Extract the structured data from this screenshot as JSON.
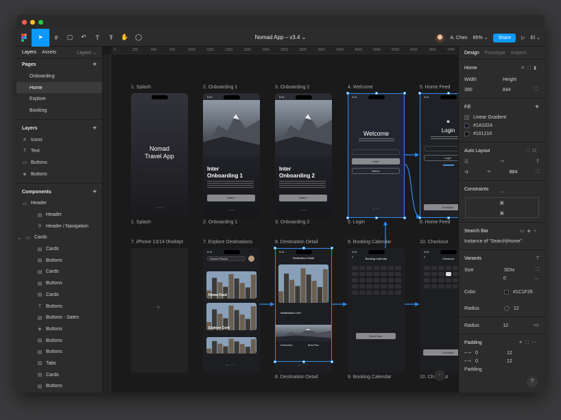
{
  "app": {
    "title": "Nomad App – v3.4",
    "user_name": "A. Chen",
    "zoom": "85%",
    "share_label": "Share",
    "dev_label": "Eİ"
  },
  "left_panel": {
    "tabs": [
      "Layers",
      "Assets"
    ],
    "tab_right": "Layers",
    "pages_title": "Pages",
    "pages": [
      "Onboarding",
      "Home",
      "Explore",
      "Booking"
    ],
    "layers_title": "Layers",
    "layers": [
      {
        "icon": "#",
        "label": "Icons"
      },
      {
        "icon": "T",
        "label": "Text"
      },
      {
        "icon": "▭",
        "label": "Buttons"
      },
      {
        "icon": "◈",
        "label": "Buttons"
      }
    ],
    "components_title": "Components",
    "components": [
      {
        "icon": "▭",
        "label": "Header",
        "indent": 0
      },
      {
        "icon": "▤",
        "label": "Header",
        "indent": 1
      },
      {
        "icon": "⚲",
        "label": "Header / Navigation",
        "indent": 1
      },
      {
        "icon": "▭",
        "label": "Cards",
        "indent": 0
      },
      {
        "icon": "▤",
        "label": "Cards",
        "indent": 1
      },
      {
        "icon": "▤",
        "label": "Buttons",
        "indent": 1
      },
      {
        "icon": "▤",
        "label": "Cards",
        "indent": 1
      },
      {
        "icon": "▤",
        "label": "Buttons",
        "indent": 1
      },
      {
        "icon": "▤",
        "label": "Cards",
        "indent": 1
      },
      {
        "icon": "T",
        "label": "Buttons",
        "indent": 1
      },
      {
        "icon": "▤",
        "label": "Buttons - Sates",
        "indent": 1
      },
      {
        "icon": "◈",
        "label": "Buttons",
        "indent": 1
      },
      {
        "icon": "▤",
        "label": "Buttons",
        "indent": 1
      },
      {
        "icon": "▤",
        "label": "Buttons",
        "indent": 1
      },
      {
        "icon": "▤",
        "label": "Tabs",
        "indent": 1
      },
      {
        "icon": "▤",
        "label": "Cards",
        "indent": 1
      },
      {
        "icon": "▤",
        "label": "Buttons",
        "indent": 1
      }
    ]
  },
  "canvas": {
    "ruler_ticks": [
      "0",
      "250",
      "400",
      "500",
      "1000",
      "1500",
      "1000",
      "1500",
      "2000",
      "2500",
      "3000",
      "3500",
      "4000",
      "4500",
      "5000",
      "5500",
      "6000",
      "1800",
      "7000"
    ],
    "frames": [
      {
        "label": "1. Splash",
        "bottom_label": "1. Splash",
        "title": "Nomad\nTravel App"
      },
      {
        "label": "2. Onboarding 1",
        "bottom_label": "2. Onboarding 1",
        "title": "Inter\nOnboarding 1",
        "button": "Button"
      },
      {
        "label": "3. Onboarding 2",
        "bottom_label": "3. Onboarding 2",
        "title": "Inter\nOnboarding 2",
        "button": "Button"
      },
      {
        "label": "4. Welcome",
        "bottom_label": "5. Login",
        "title": "Welcome",
        "login": "Login",
        "button": "Button"
      },
      {
        "label": "5. Home Feed",
        "bottom_label": "6. Home Feed",
        "title": "Login",
        "login": "Login",
        "extra": "Prototype"
      },
      {
        "label": "7. iPhone 13/14 0hx84pt",
        "bottom_label": ""
      },
      {
        "label": "7. Explore Destinations",
        "bottom_label": "",
        "search": "Search Places",
        "card1": "Home Feed",
        "card2": "Explore Cent"
      },
      {
        "label": "8. Destination Detail",
        "bottom_label": "8. Destination Detail",
        "title": "Destination Detail",
        "card": "Destination Cent",
        "thumb1": "Destination",
        "thumb2": "Build Plan"
      },
      {
        "label": "9. Booking Calendar",
        "bottom_label": "9. Booking Calendar",
        "title": "Booking Calendar",
        "button": "Book Now"
      },
      {
        "label": "10. Checkout",
        "bottom_label": "10. Checkout",
        "title": "Checkout",
        "button": "Checkout"
      }
    ],
    "status_time": "9:41"
  },
  "right_panel": {
    "tabs": [
      "Design",
      "Prototype",
      "Inspect"
    ],
    "home_title": "Home",
    "width_label": "Width",
    "height_label": "Height",
    "width": "390",
    "height": "844",
    "fill_title": "Fill",
    "fills": [
      "Linear Gradient",
      "#1A1024",
      "#101216"
    ],
    "auto_layout_title": "Auto Layout",
    "auto_layout_value": "884",
    "constraints_title": "Constraints",
    "search_bar_title": "Search Bar",
    "instance_of": "Instance of \"Search|Home\"",
    "variants_title": "Variants",
    "size_label": "Size",
    "size_value": "SDIx",
    "size_value2": "0",
    "color_label": "Color",
    "color_value": "#1C1F26",
    "radius_label": "Radius",
    "radius_value": "12",
    "radius2_label": "Radius",
    "radius2_value": "12",
    "padding_title": "Padding",
    "padding_rows": [
      {
        "a": "0",
        "b": "12"
      },
      {
        "a": "0",
        "b": "12"
      }
    ],
    "padding_more": "Padding"
  },
  "colors": {
    "accent": "#0d99ff",
    "selection": "#2d8ff0",
    "canvas_bg": "#1a1a1a",
    "panel_bg": "#2c2c2c"
  }
}
